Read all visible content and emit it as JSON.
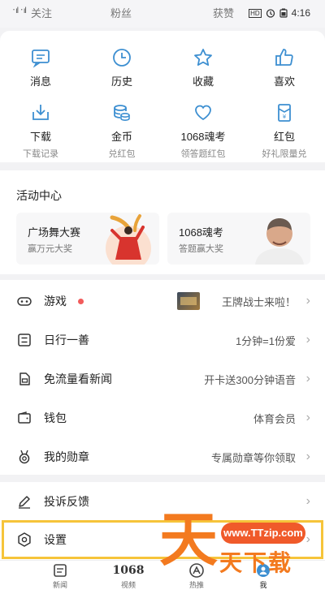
{
  "status_bar": {
    "left_faded": "关注",
    "center_faded": "粉丝",
    "right_faded": "获赞",
    "signal": "᛫ıl ᛫ıl",
    "hd": "HD",
    "time": "4:16"
  },
  "grid_row1": [
    {
      "label": "消息",
      "icon": "message-icon"
    },
    {
      "label": "历史",
      "icon": "clock-icon"
    },
    {
      "label": "收藏",
      "icon": "star-icon"
    },
    {
      "label": "喜欢",
      "icon": "thumbs-up-icon"
    }
  ],
  "grid_row2": [
    {
      "label": "下载",
      "sub": "下载记录",
      "icon": "download-icon"
    },
    {
      "label": "金币",
      "sub": "兑红包",
      "icon": "coins-icon"
    },
    {
      "label": "1068魂考",
      "sub": "领答题红包",
      "icon": "heart-icon"
    },
    {
      "label": "红包",
      "sub": "好礼限量兑",
      "icon": "red-packet-icon"
    }
  ],
  "activity": {
    "title": "活动中心",
    "banners": [
      {
        "title": "广场舞大赛",
        "subtitle": "赢万元大奖"
      },
      {
        "title": "1068魂考",
        "subtitle": "答题赢大奖"
      }
    ]
  },
  "list": [
    {
      "name": "游戏",
      "value": "王牌战士来啦！",
      "icon": "gamepad-icon"
    },
    {
      "name": "日行一善",
      "value": "1分钟=1份爱",
      "icon": "charity-icon"
    },
    {
      "name": "免流量看新闻",
      "value": "开卡送300分钟语音",
      "icon": "sim-card-icon"
    },
    {
      "name": "钱包",
      "value": "体育会员",
      "icon": "wallet-icon"
    },
    {
      "name": "我的勋章",
      "value": "专属勋章等你领取",
      "icon": "medal-icon"
    }
  ],
  "list2": [
    {
      "name": "投诉反馈",
      "icon": "edit-icon"
    },
    {
      "name": "设置",
      "icon": "settings-icon"
    }
  ],
  "tabs": [
    {
      "label": "新闻",
      "icon": "news-icon"
    },
    {
      "label": "视频",
      "icon": "1068",
      "icon_text": "1068"
    },
    {
      "label": "热推",
      "icon": "hot-icon"
    },
    {
      "label": "我",
      "icon": "me-icon"
    }
  ],
  "watermark": {
    "url": "www.TTzip.com",
    "char": "天",
    "text": "天下载"
  },
  "colors": {
    "accent_blue": "#3d8fd1",
    "red_dot": "#f25b5b",
    "highlight": "#f6c43a",
    "watermark": "#f37a1f"
  }
}
